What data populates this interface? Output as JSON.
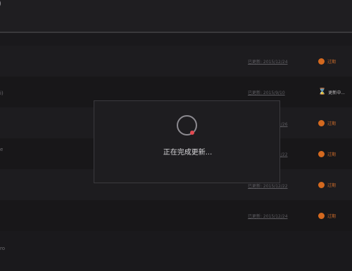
{
  "topbar": {
    "glyph": ")"
  },
  "rows": [
    {
      "link": "已更新: 2015/12/24",
      "status": "过期",
      "status_type": "expired"
    },
    {
      "link": "已更新: 2015/9/10",
      "status": "更新中...",
      "status_type": "updating",
      "edge": "i)"
    },
    {
      "link": "已更新: 2015/12/26",
      "status": "过期",
      "status_type": "expired"
    },
    {
      "link": "已更新: 2015/12/22",
      "status": "过期",
      "status_type": "expired",
      "edge": "e"
    },
    {
      "link": "已更新: 2015/12/22",
      "status": "过期",
      "status_type": "expired"
    },
    {
      "link": "已更新: 2015/12/24",
      "status": "过期",
      "status_type": "expired"
    }
  ],
  "bottom_edge": "ro",
  "modal": {
    "message": "正在完成更新..."
  },
  "colors": {
    "expired": "#d4691f",
    "spinner_dot": "#e44a52",
    "background": "#1a191c"
  }
}
